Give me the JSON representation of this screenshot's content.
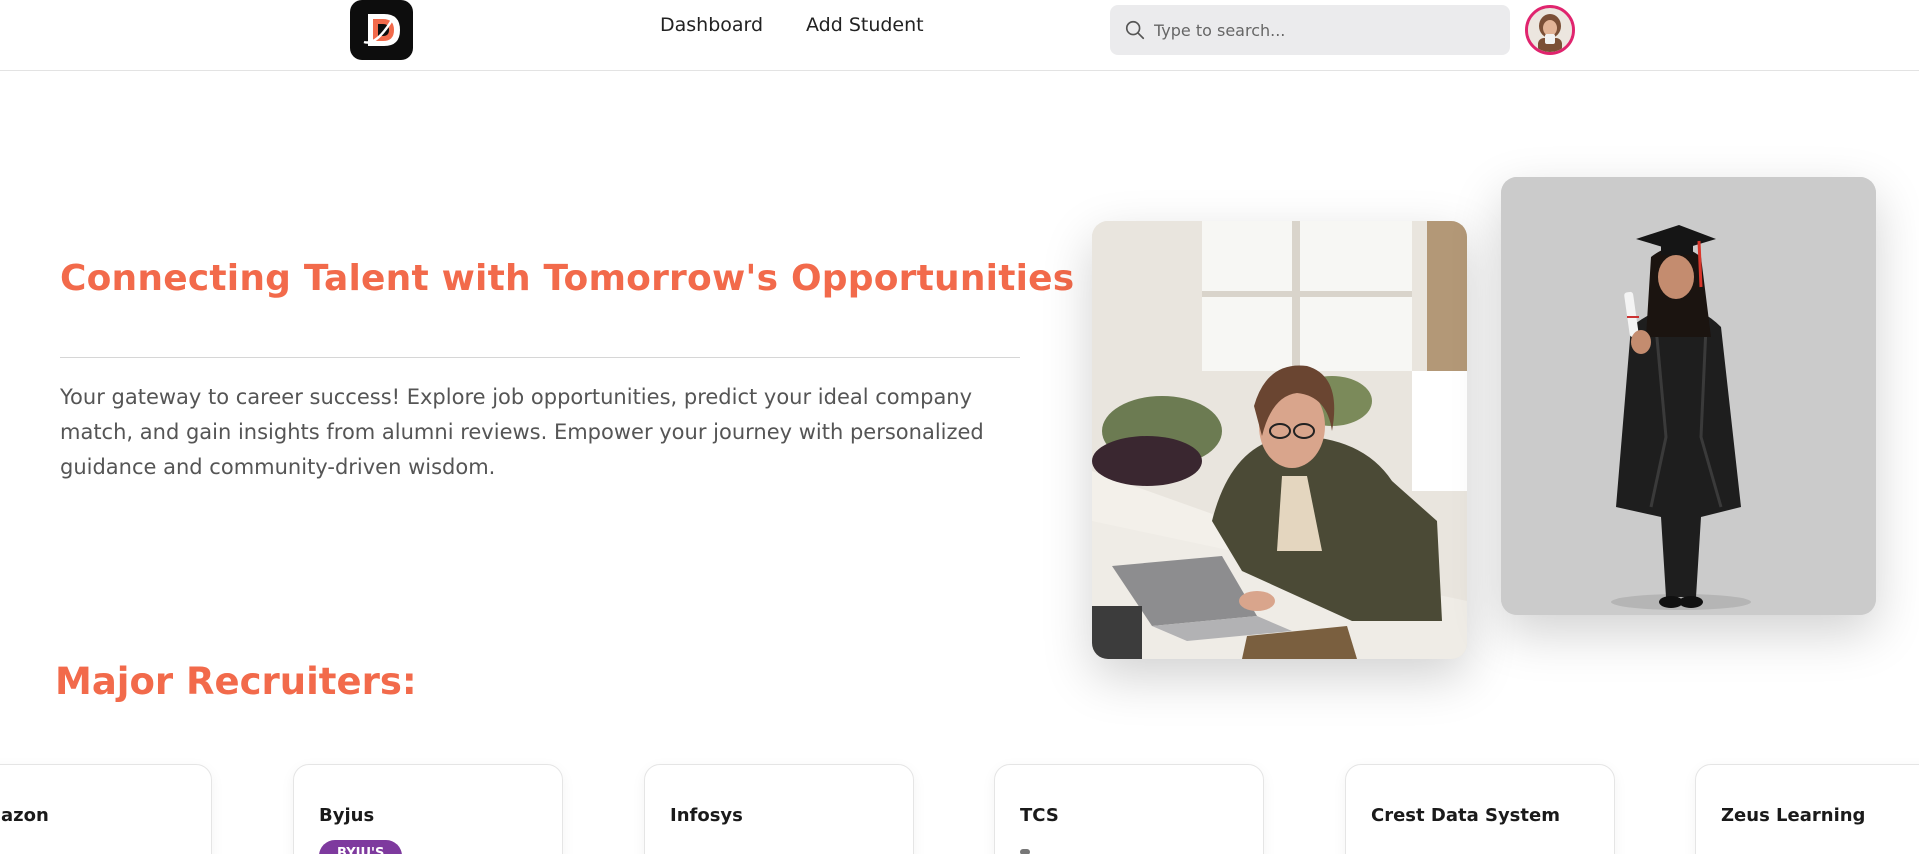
{
  "nav": {
    "logo_letter": "D",
    "links": [
      "Dashboard",
      "Add Student"
    ],
    "search_placeholder": "Type to search..."
  },
  "hero": {
    "title": "Connecting Talent with Tomorrow's Opportunities",
    "description": "Your gateway to career success! Explore job opportunities, predict your ideal company match, and gain insights from alumni reviews. Empower your journey with personalized guidance and community-driven wisdom."
  },
  "recruiters": {
    "title": "Major Recruiters:",
    "companies": [
      {
        "name": "azon"
      },
      {
        "name": "Byjus",
        "badge": "BYJU'S"
      },
      {
        "name": "Infosys"
      },
      {
        "name": "TCS"
      },
      {
        "name": "Crest Data System"
      },
      {
        "name": "Zeus Learning"
      }
    ]
  },
  "colors": {
    "accent": "#f26a4b",
    "avatar_ring": "#e0246e",
    "badge": "#7e3a9e"
  }
}
